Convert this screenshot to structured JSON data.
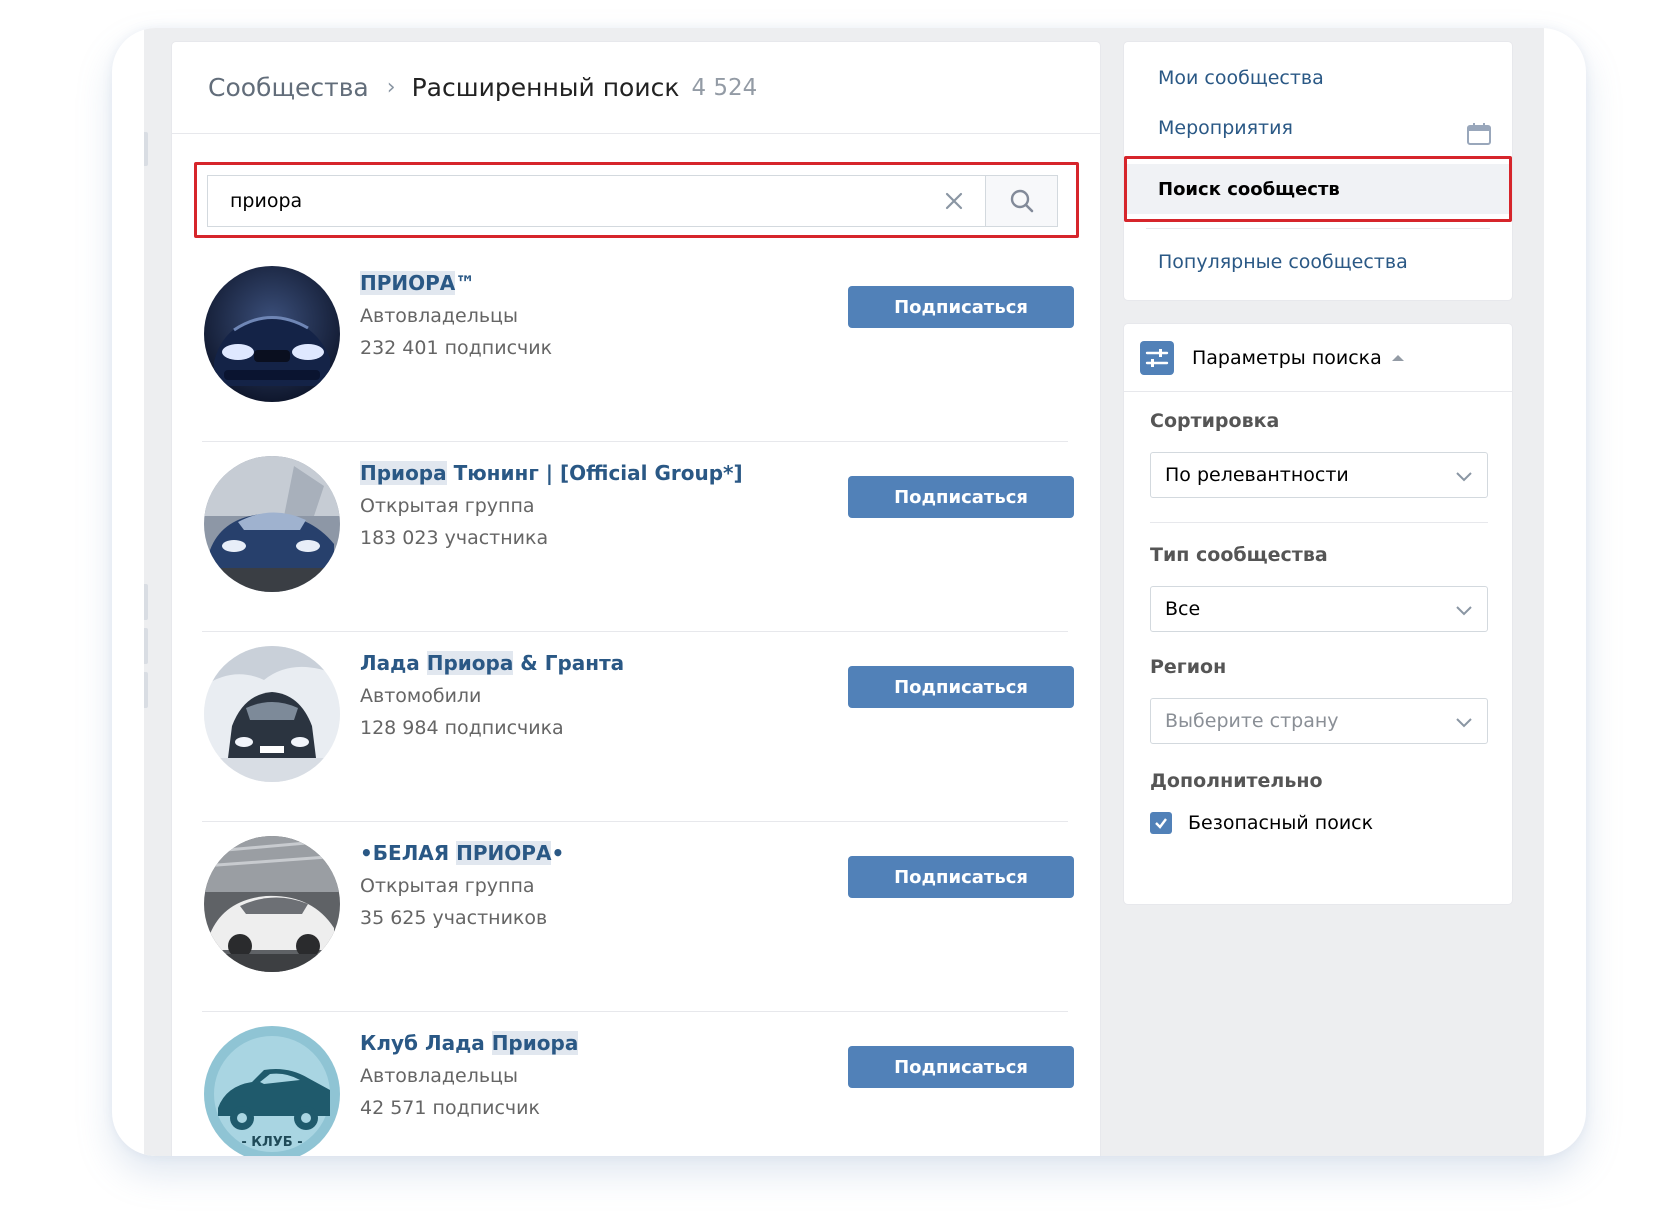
{
  "breadcrumb": {
    "root": "Сообщества",
    "separator": "›",
    "current": "Расширенный поиск",
    "count": "4 524"
  },
  "search": {
    "value": "приора",
    "clear_icon": "close-icon",
    "search_icon": "search-icon"
  },
  "results": [
    {
      "name_pre": "",
      "name_hl": "ПРИОРА",
      "name_post": "™",
      "category": "Автовладельцы",
      "count": "232 401 подписчик",
      "button": "Подписаться"
    },
    {
      "name_pre": "",
      "name_hl": "Приора",
      "name_post": " Тюнинг | [Official Group*]",
      "category": "Открытая группа",
      "count": "183 023 участника",
      "button": "Подписаться"
    },
    {
      "name_pre": "Лада ",
      "name_hl": "Приора",
      "name_post": " & Гранта",
      "category": "Автомобили",
      "count": "128 984 подписчика",
      "button": "Подписаться"
    },
    {
      "name_pre": "•БЕЛАЯ ",
      "name_hl": "ПРИОРА",
      "name_post": "•",
      "category": "Открытая группа",
      "count": "35 625 участников",
      "button": "Подписаться"
    },
    {
      "name_pre": "Клуб Лада ",
      "name_hl": "Приора",
      "name_post": "",
      "category": "Автовладельцы",
      "count": "42 571 подписчик",
      "button": "Подписаться",
      "avatar_text": "- КЛУБ -"
    }
  ],
  "menu": {
    "items": [
      {
        "label": "Мои сообщества"
      },
      {
        "label": "Мероприятия"
      },
      {
        "label": "Поиск сообществ"
      },
      {
        "label": "Популярные сообщества"
      }
    ],
    "calendar_icon": "calendar-icon"
  },
  "params": {
    "title": "Параметры поиска",
    "sort_label": "Сортировка",
    "sort_value": "По релевантности",
    "type_label": "Тип сообщества",
    "type_value": "Все",
    "region_label": "Регион",
    "region_placeholder": "Выберите страну",
    "extra_label": "Дополнительно",
    "safe_search_label": "Безопасный поиск",
    "safe_search_checked": true
  },
  "colors": {
    "link": "#2a5885",
    "button": "#5181b8",
    "highlight_frame": "#d6252b",
    "background": "#edeef0"
  }
}
